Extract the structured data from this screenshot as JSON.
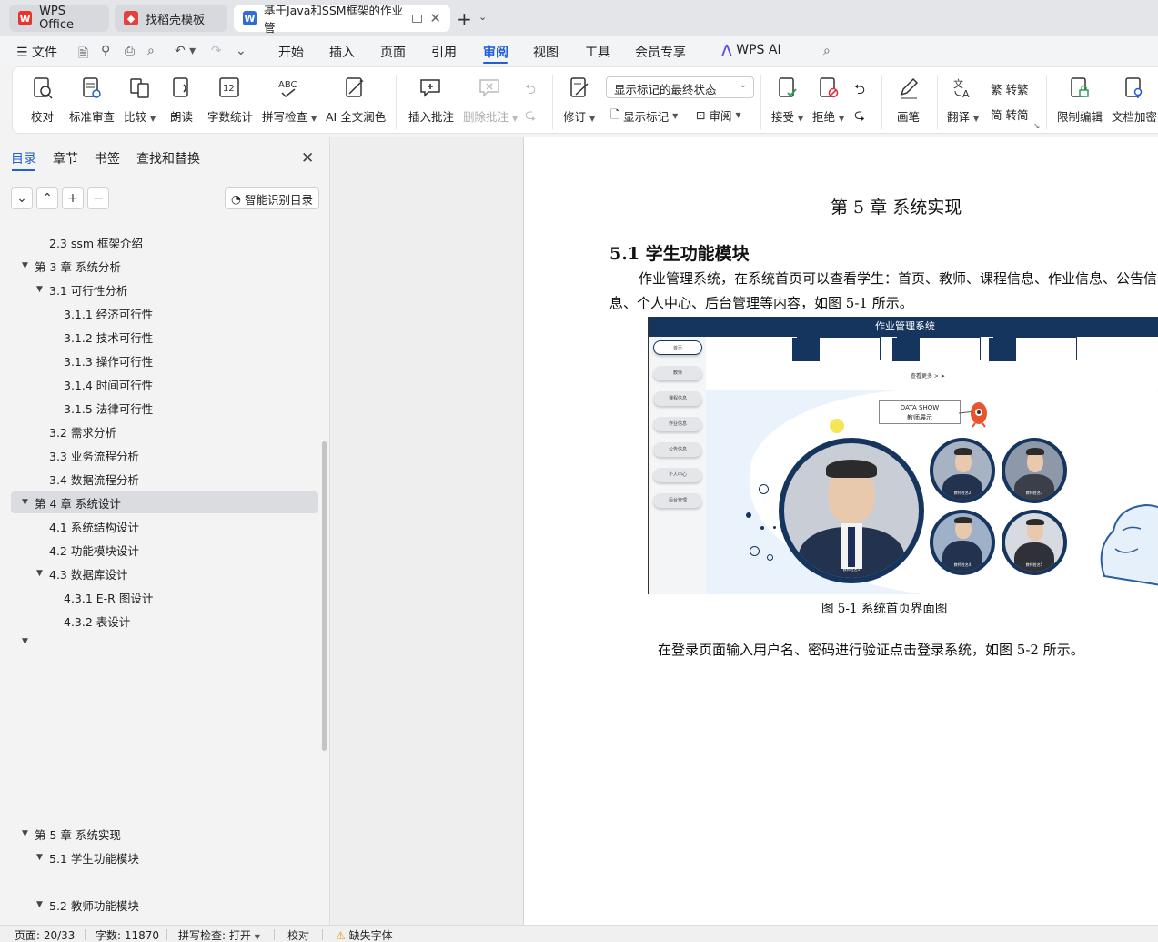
{
  "tabs": [
    {
      "label": "WPS Office",
      "icon": "wps-logo-icon"
    },
    {
      "label": "找稻壳模板",
      "icon": "docer-icon"
    },
    {
      "label": "基于Java和SSM框架的作业管",
      "icon": "word-doc-icon"
    }
  ],
  "menu": {
    "file": "文件",
    "items": [
      "开始",
      "插入",
      "页面",
      "引用",
      "审阅",
      "视图",
      "工具",
      "会员专享"
    ],
    "active": "审阅",
    "ai": "WPS AI"
  },
  "ribbon": {
    "proofread": "校对",
    "standard_review": "标准审查",
    "compare": "比较",
    "read_aloud": "朗读",
    "word_count": "字数统计",
    "spell_check": "拼写检查",
    "ai_polish": "AI 全文润色",
    "insert_comment": "插入批注",
    "delete_comment": "删除批注",
    "track_changes": "修订",
    "display_mode": "显示标记的最终状态",
    "show_markup": "显示标记",
    "review": "审阅",
    "accept": "接受",
    "reject": "拒绝",
    "pen": "画笔",
    "translate": "翻译",
    "to_traditional": "转繁",
    "to_simplified": "转简",
    "restrict_edit": "限制编辑",
    "doc_encrypt": "文档加密"
  },
  "nav": {
    "tabs": [
      "目录",
      "章节",
      "书签",
      "查找和替换"
    ],
    "smart_btn": "智能识别目录",
    "toc": [
      {
        "text": "2.3 ssm 框架介绍",
        "level": 2,
        "arrow": ""
      },
      {
        "text": "第 3 章  系统分析",
        "level": 1,
        "arrow": "▼"
      },
      {
        "text": "3.1 可行性分析",
        "level": 2,
        "arrow": "▼"
      },
      {
        "text": "3.1.1 经济可行性",
        "level": 3,
        "arrow": ""
      },
      {
        "text": "3.1.2 技术可行性",
        "level": 3,
        "arrow": ""
      },
      {
        "text": "3.1.3 操作可行性",
        "level": 3,
        "arrow": ""
      },
      {
        "text": "3.1.4  时间可行性",
        "level": 3,
        "arrow": ""
      },
      {
        "text": "3.1.5  法律可行性",
        "level": 3,
        "arrow": ""
      },
      {
        "text": "3.2 需求分析",
        "level": 2,
        "arrow": ""
      },
      {
        "text": "3.3 业务流程分析",
        "level": 2,
        "arrow": ""
      },
      {
        "text": "3.4 数据流程分析",
        "level": 2,
        "arrow": ""
      },
      {
        "text": "第 4 章  系统设计",
        "level": 1,
        "arrow": "▼"
      },
      {
        "text": "4.1 系统结构设计",
        "level": 2,
        "arrow": ""
      },
      {
        "text": "4.2 功能模块设计",
        "level": 2,
        "arrow": ""
      },
      {
        "text": "4.3 数据库设计",
        "level": 2,
        "arrow": "▼"
      },
      {
        "text": "4.3.1 E-R 图设计",
        "level": 3,
        "arrow": ""
      },
      {
        "text": "4.3.2 表设计",
        "level": 3,
        "arrow": ""
      }
    ],
    "toc_bottom": [
      {
        "text": "第 5 章    系统实现",
        "level": 1,
        "arrow": "▼"
      },
      {
        "text": "5.1  学生功能模块",
        "level": 2,
        "arrow": "▼"
      },
      {
        "text": "5.2  教师功能模块",
        "level": 2,
        "arrow": "▼"
      }
    ]
  },
  "doc": {
    "chapter_title": "第 5 章   系统实现",
    "section_title": "5.1  学生功能模块",
    "paragraph": "作业管理系统，在系统首页可以查看学生：首页、教师、课程信息、作业信息、公告信息、个人中心、后台管理等内容，如图 5-1 所示。",
    "caption": "图 5-1 系统首页界面图",
    "paragraph2": "在登录页面输入用户名、密码进行验证点击登录系统，如图 5-2 所示。",
    "figure": {
      "header": "作业管理系统",
      "side_items": [
        "首页",
        "教师",
        "课程信息",
        "作业信息",
        "公告信息",
        "个人中心",
        "后台管理"
      ],
      "more": "查看更多 >",
      "data_show_1": "DATA SHOW",
      "data_show_2": "教师展示",
      "teacher_names": [
        "教师姓名1",
        "教师姓名2",
        "教师姓名3",
        "教师姓名4",
        "教师姓名5"
      ]
    }
  },
  "status": {
    "page": "页面: 20/33",
    "words": "字数: 11870",
    "spell": "拼写检查: 打开",
    "proof": "校对",
    "missing_font": "缺失字体"
  },
  "colors": {
    "accent": "#1f5ed8",
    "figure_navy": "#15345e"
  }
}
